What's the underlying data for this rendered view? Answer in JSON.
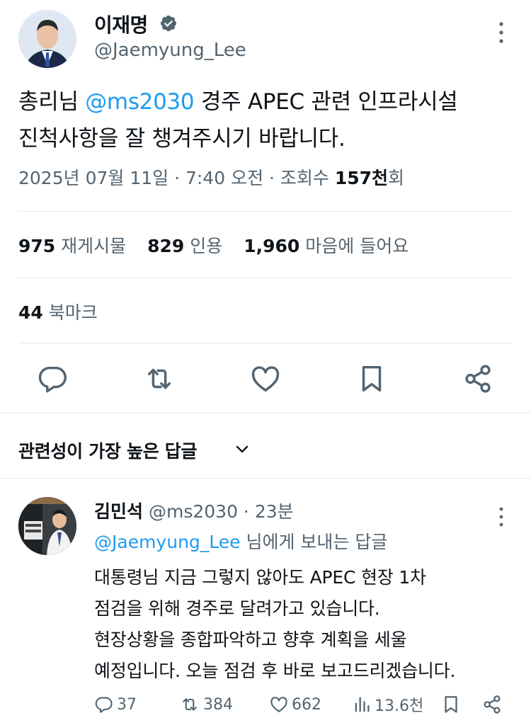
{
  "author": {
    "name": "이재명",
    "handle": "@Jaemyung_Lee",
    "verified_color": "#536471"
  },
  "tweet": {
    "text_prefix": "총리님 ",
    "mention": "@ms2030",
    "text_line1_rest": " 경주 APEC 관련 인프라시설",
    "text_line2": "진척사항을 잘 챙겨주시기 바랍니다.",
    "date_time": "2025년 07월 11일 · 7:40 오전 · 조회수 ",
    "views": "157천",
    "views_suffix": "회"
  },
  "stats": {
    "reposts_count": "975",
    "reposts_label": "재게시물",
    "quotes_count": "829",
    "quotes_label": "인용",
    "likes_count": "1,960",
    "likes_label": "마음에 들어요",
    "bookmarks_count": "44",
    "bookmarks_label": "북마크"
  },
  "actions": [
    "reply-icon",
    "repost-icon",
    "like-icon",
    "bookmark-icon",
    "share-icon"
  ],
  "replies_sort": {
    "label": "관련성이 가장 높은 답글"
  },
  "reply": {
    "name": "김민석",
    "handle": "@ms2030",
    "time": " · 23분",
    "replying_to": "@Jaemyung_Lee",
    "replying_suffix": " 님에게 보내는 답글",
    "lines": [
      "대통령님 지금 그렇지 않아도 APEC 현장 1차",
      "점검을 위해 경주로 달려가고 있습니다.",
      "현장상황을 종합파악하고 향후 계획을 세울",
      "예정입니다. 오늘 점검 후 바로 보고드리겠습니다."
    ],
    "replies": "37",
    "reposts": "384",
    "likes": "662",
    "views": "13.6천"
  },
  "colors": {
    "accent": "#1d9bf0",
    "muted": "#536471",
    "text": "#0f1419"
  }
}
